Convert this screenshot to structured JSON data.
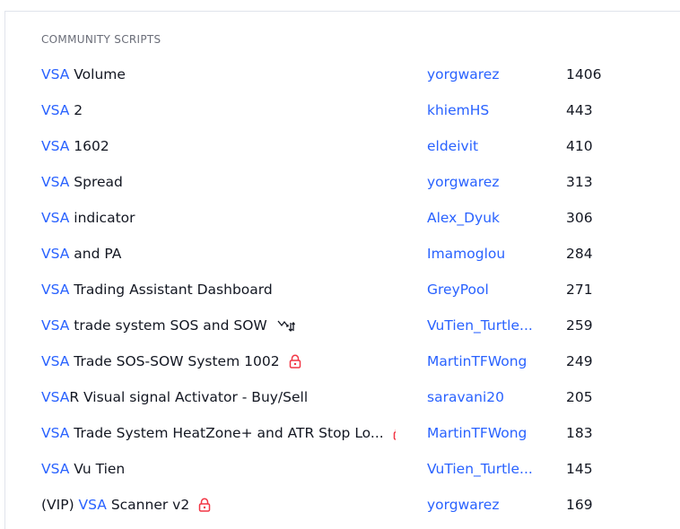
{
  "section": {
    "title": "COMMUNITY SCRIPTS"
  },
  "colors": {
    "accent": "#2962ff",
    "lock": "#f23645",
    "text": "#131722",
    "muted": "#6a6d78"
  },
  "rows": [
    {
      "prefix": "",
      "highlight": "VSA",
      "rest": " Volume",
      "author": "yorgwarez",
      "count": "1406",
      "icon": ""
    },
    {
      "prefix": "",
      "highlight": "VSA",
      "rest": " 2",
      "author": "khiemHS",
      "count": "443",
      "icon": ""
    },
    {
      "prefix": "",
      "highlight": "VSA",
      "rest": " 1602",
      "author": "eldeivit",
      "count": "410",
      "icon": ""
    },
    {
      "prefix": "",
      "highlight": "VSA",
      "rest": " Spread",
      "author": "yorgwarez",
      "count": "313",
      "icon": ""
    },
    {
      "prefix": "",
      "highlight": "VSA",
      "rest": " indicator",
      "author": "Alex_Dyuk",
      "count": "306",
      "icon": ""
    },
    {
      "prefix": "",
      "highlight": "VSA",
      "rest": " and PA",
      "author": "Imamoglou",
      "count": "284",
      "icon": ""
    },
    {
      "prefix": "",
      "highlight": "VSA",
      "rest": " Trading Assistant Dashboard",
      "author": "GreyPool",
      "count": "271",
      "icon": ""
    },
    {
      "prefix": "",
      "highlight": "VSA",
      "rest": " trade system SOS and SOW",
      "author": "VuTien_Turtle...",
      "count": "259",
      "icon": "strategy-icon"
    },
    {
      "prefix": "",
      "highlight": "VSA",
      "rest": " Trade SOS-SOW System 1002",
      "author": "MartinTFWong",
      "count": "249",
      "icon": "lock-icon"
    },
    {
      "prefix": "",
      "highlight": "VSA",
      "rest": "R Visual signal Activator - Buy/Sell",
      "author": "saravani20",
      "count": "205",
      "icon": ""
    },
    {
      "prefix": "",
      "highlight": "VSA",
      "rest": " Trade System HeatZone+ and ATR Stop Lo...",
      "author": "MartinTFWong",
      "count": "183",
      "icon": "lock-icon"
    },
    {
      "prefix": "",
      "highlight": "VSA",
      "rest": " Vu Tien",
      "author": "VuTien_Turtle...",
      "count": "145",
      "icon": ""
    },
    {
      "prefix": "(VIP) ",
      "highlight": "VSA",
      "rest": " Scanner v2",
      "author": "yorgwarez",
      "count": "169",
      "icon": "lock-icon"
    }
  ]
}
